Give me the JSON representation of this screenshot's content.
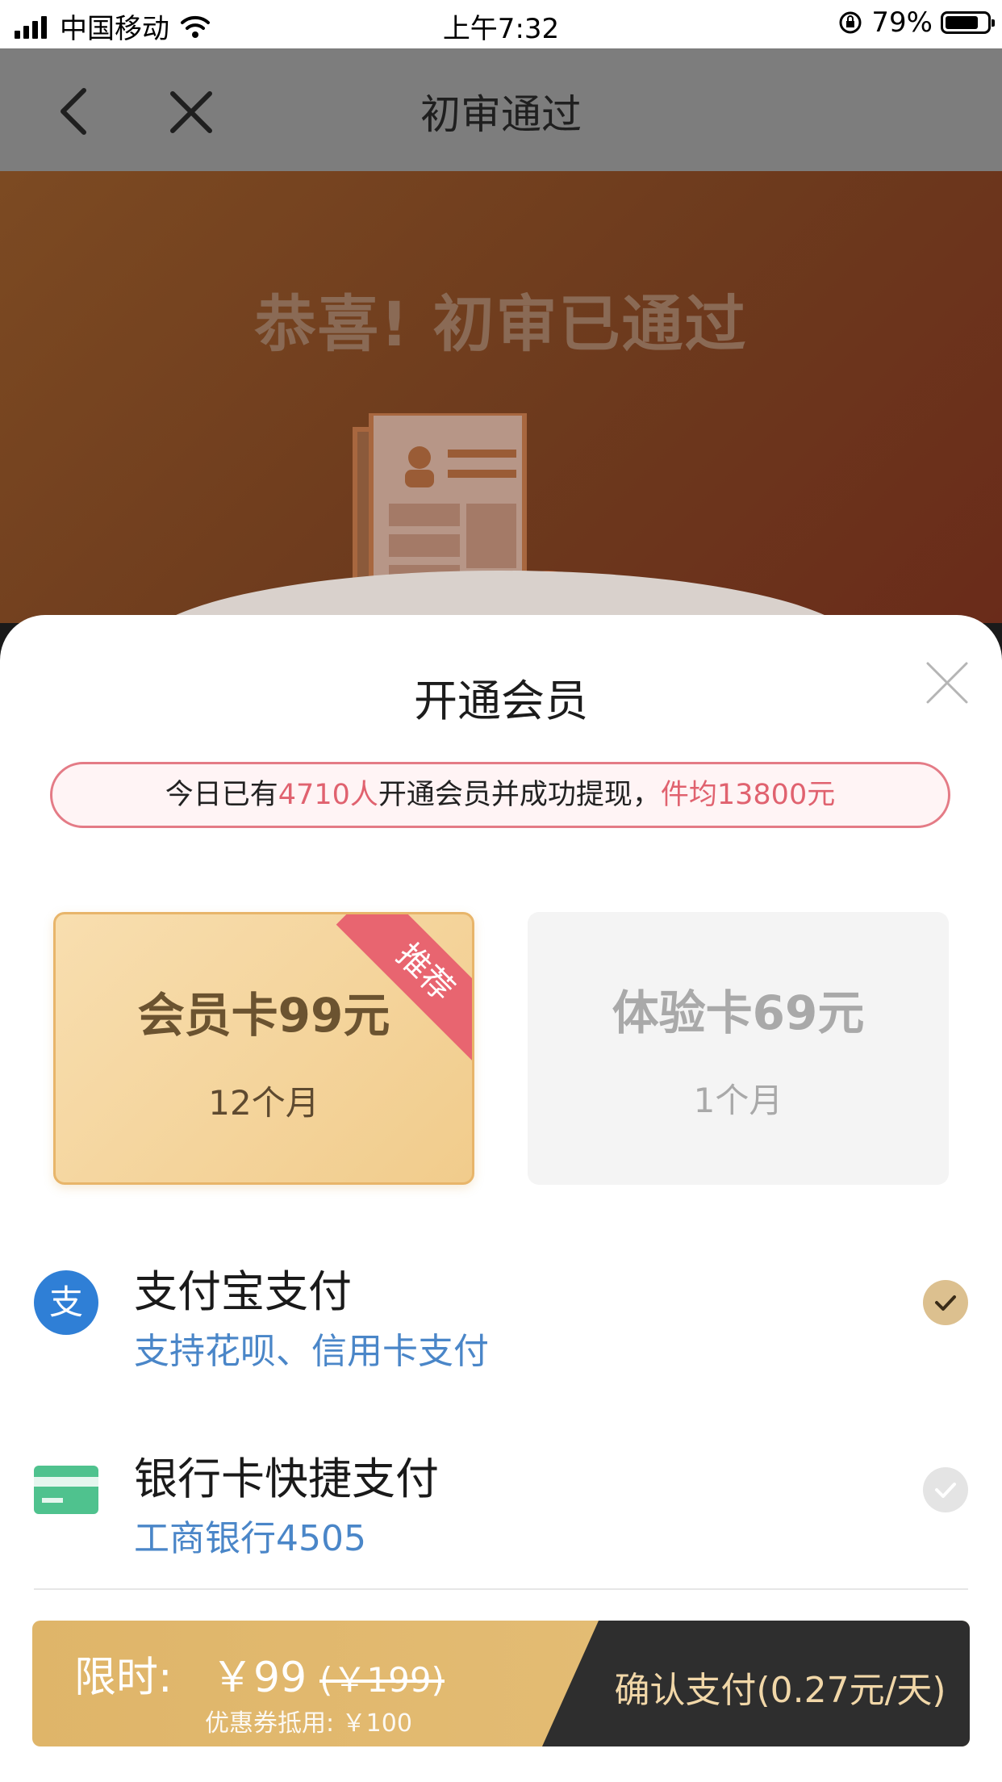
{
  "status_bar": {
    "carrier": "中国移动",
    "time": "上午7:32",
    "battery": "79%",
    "battery_level": 0.79
  },
  "navbar": {
    "title": "初审通过",
    "back_icon": "chevron-left-icon",
    "close_icon": "close-icon"
  },
  "hero": {
    "title": "恭喜! 初审已通过"
  },
  "sheet": {
    "title": "开通会员",
    "notice": {
      "prefix": "今日已有",
      "count": "4710人",
      "middle": "开通会员并成功提现，",
      "average": "件均13800元"
    },
    "plans": [
      {
        "name": "会员卡99元",
        "term": "12个月",
        "badge": "推荐",
        "selected": true
      },
      {
        "name": "体验卡69元",
        "term": "1个月",
        "selected": false
      }
    ],
    "payments": [
      {
        "name": "支付宝支付",
        "sub": "支持花呗、信用卡支付",
        "icon": "alipay-icon",
        "selected": true,
        "icon_glyph": "支"
      },
      {
        "name": "银行卡快捷支付",
        "sub": "工商银行4505",
        "icon": "bank-card-icon",
        "selected": false
      }
    ],
    "paybar": {
      "limit_label": "限时:",
      "price": "￥99",
      "original_price": "(￥199)",
      "coupon": "优惠券抵用: ￥100",
      "confirm": "确认支付(0.27元/天)"
    }
  },
  "colors": {
    "accent_gold": "#dfb569",
    "highlight_red": "#e0626f",
    "link_blue": "#4a86c8",
    "dark_button": "#2e2e2e"
  }
}
